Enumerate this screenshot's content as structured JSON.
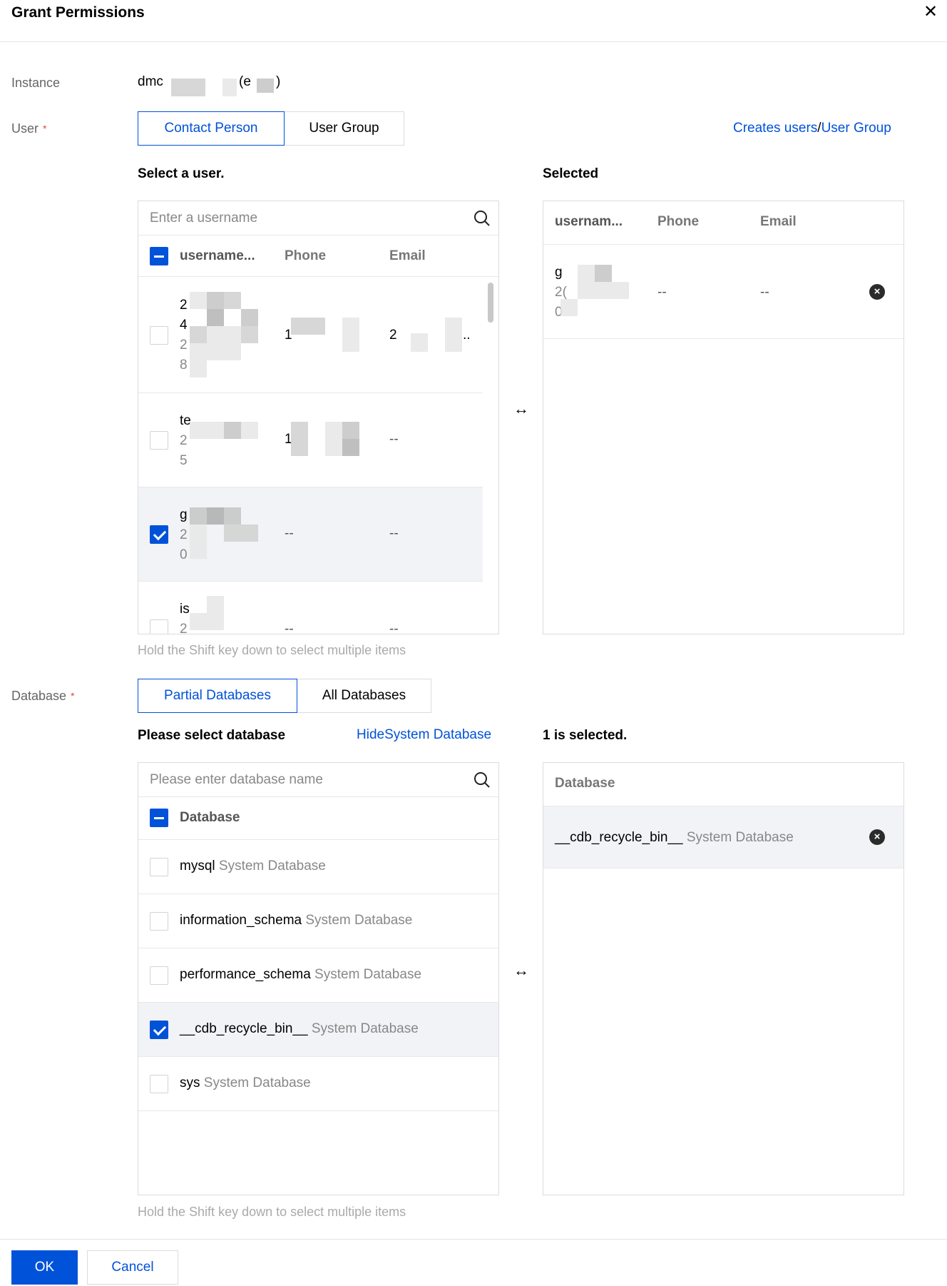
{
  "dialog": {
    "title": "Grant Permissions"
  },
  "instance": {
    "label": "Instance",
    "value_prefix": "dmc",
    "value_paren_open": "(e",
    "value_paren_close": ")"
  },
  "user": {
    "label": "User",
    "required_mark": "*",
    "tabs": [
      "Contact Person",
      "User Group"
    ],
    "active_tab": "Contact Person",
    "create_link": "Creates users",
    "link_separator": "/",
    "group_link": "User Group",
    "select_title": "Select a user.",
    "selected_title": "Selected",
    "search_placeholder": "Enter a username",
    "columns": [
      "username...",
      "Phone",
      "Email"
    ],
    "selected_columns": [
      "usernam...",
      "Phone",
      "Email"
    ],
    "rows": [
      {
        "lines": [
          "2",
          "4",
          "2",
          "8"
        ],
        "phone": "1",
        "email": "2",
        "email_tail": "..",
        "checked": false
      },
      {
        "lines": [
          "te",
          "2",
          "5"
        ],
        "phone": "1",
        "email": "--",
        "checked": false
      },
      {
        "lines": [
          "g",
          "2",
          "0"
        ],
        "phone": "--",
        "email": "--",
        "checked": true
      },
      {
        "lines": [
          "is",
          "2"
        ],
        "phone": "--",
        "email": "--",
        "checked": false
      }
    ],
    "selected_rows": [
      {
        "lines": [
          "g",
          "2(",
          "0"
        ],
        "phone": "--",
        "email": "--"
      }
    ],
    "hint": "Hold the Shift key down to select multiple items"
  },
  "database": {
    "label": "Database",
    "required_mark": "*",
    "tabs": [
      "Partial Databases",
      "All Databases"
    ],
    "active_tab": "Partial Databases",
    "select_title": "Please select database",
    "hide_link": "HideSystem Database",
    "selected_title": "1 is selected.",
    "search_placeholder": "Please enter database name",
    "column": "Database",
    "selected_column": "Database",
    "items": [
      {
        "name": "mysql",
        "tag": "System Database",
        "checked": false
      },
      {
        "name": "information_schema",
        "tag": "System Database",
        "checked": false
      },
      {
        "name": "performance_schema",
        "tag": "System Database",
        "checked": false
      },
      {
        "name": "__cdb_recycle_bin__",
        "tag": "System Database",
        "checked": true
      },
      {
        "name": "sys",
        "tag": "System Database",
        "checked": false
      }
    ],
    "selected_items": [
      {
        "name": "__cdb_recycle_bin__",
        "tag": "System Database"
      }
    ],
    "hint": "Hold the Shift key down to select multiple items"
  },
  "footer": {
    "ok": "OK",
    "cancel": "Cancel"
  },
  "icons": {
    "close": "close-icon",
    "search": "search-icon",
    "transfer": "transfer-icon",
    "remove": "remove-icon"
  },
  "colors": {
    "primary": "#0052d9",
    "required": "#e54545",
    "selected_row": "#f2f3f6"
  }
}
